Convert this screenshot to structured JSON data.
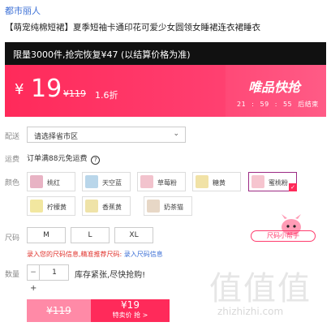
{
  "store": {
    "name": "都市丽人"
  },
  "product": {
    "title": "【萌宠纯棉短裙】夏季短袖卡通印花可爱少女圆领女睡裙连衣裙睡衣"
  },
  "promo": {
    "banner_text": "限量3000件,抢完恢复¥47 (以结算价格为准)",
    "currency": "¥",
    "price": "19",
    "original_price": "¥119",
    "discount": "1.6折",
    "tag": "唯品快抢",
    "timer": {
      "hours": "21",
      "sep1": ":",
      "minutes": "59",
      "sep2": ":",
      "seconds": "55",
      "suffix": "后结束"
    }
  },
  "delivery": {
    "label": "配送",
    "region_placeholder": "请选择省市区"
  },
  "shipping": {
    "label": "运费",
    "text": "订单满88元免运费",
    "help_glyph": "?"
  },
  "colors": {
    "label": "颜色",
    "items": [
      {
        "label": "桃红",
        "swatch": "#e8b3c4"
      },
      {
        "label": "天空蓝",
        "swatch": "#b9d6ea"
      },
      {
        "label": "草莓粉",
        "swatch": "#f2c3cd"
      },
      {
        "label": "糖黄",
        "swatch": "#f1e2a6"
      },
      {
        "label": "蜜桃粉",
        "swatch": "#f6c5cf"
      },
      {
        "label": "柠檬黄",
        "swatch": "#f2e7a0"
      },
      {
        "label": "香蕉黄",
        "swatch": "#efe3a8"
      },
      {
        "label": "奶茶猫",
        "swatch": "#e7d7c6"
      }
    ],
    "selected": "蜜桃粉"
  },
  "size": {
    "label": "尺码",
    "options": [
      "M",
      "L",
      "XL"
    ],
    "helper": "尺码小帮手",
    "hint_prefix": "录入您的尺码信息,精准推荐尺码:",
    "hint_link": "录入尺码信息"
  },
  "quantity": {
    "label": "数量",
    "minus": "−",
    "value": "1",
    "plus": "+",
    "stock": "库存紧张,尽快抢购!"
  },
  "actions": {
    "orig_price": "¥119",
    "buy_price": "¥19",
    "buy_label": "特卖价 抢 >"
  },
  "watermark": {
    "chars": "值值值",
    "url": "zhizhizhi.com"
  },
  "accent_colors": {
    "brand_pink": "#ff2a5a",
    "selected_border": "#9c2b84",
    "link_blue": "#3b6fd6"
  }
}
